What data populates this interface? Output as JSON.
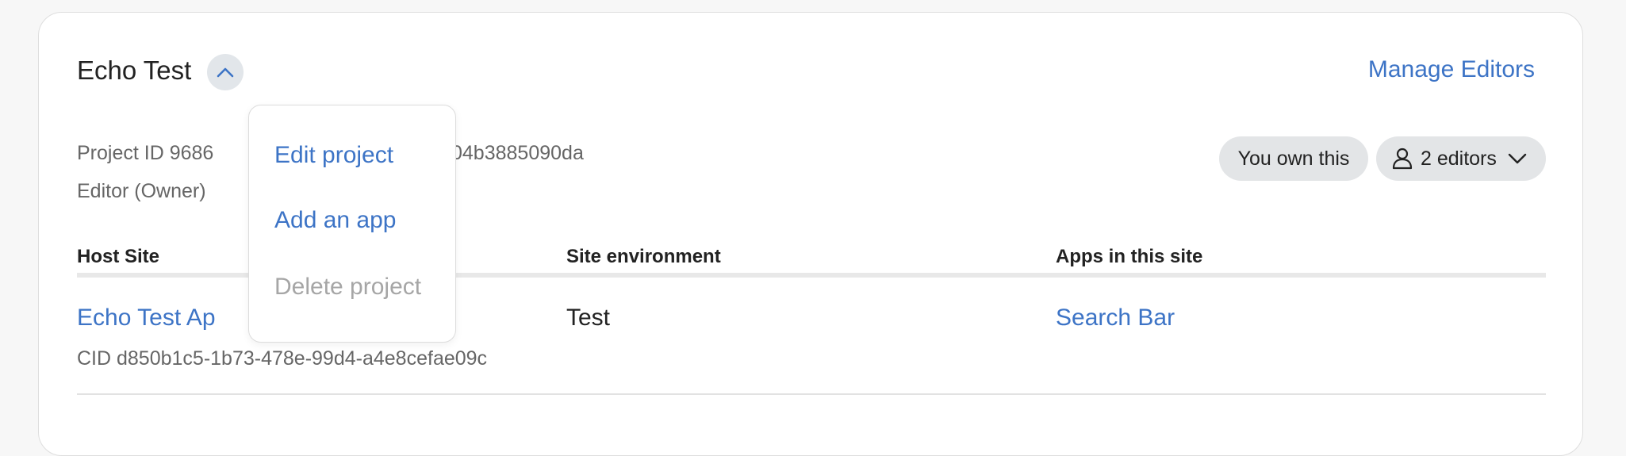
{
  "project": {
    "title": "Echo Test",
    "project_id_line": "Project ID 9686",
    "project_id_tail": "04b3885090da",
    "role_line": "Editor (Owner)"
  },
  "header": {
    "manage_editors": "Manage Editors",
    "ownership_badge": "You own this",
    "editors_count": "2 editors"
  },
  "table": {
    "columns": [
      "Host Site",
      "Site environment",
      "Apps in this site"
    ],
    "rows": [
      {
        "host_site": "Echo Test Ap",
        "environment": "Test",
        "apps": "Search Bar",
        "cid": "CID d850b1c5-1b73-478e-99d4-a4e8cefae09c"
      }
    ]
  },
  "menu": {
    "items": [
      {
        "label": "Edit project",
        "enabled": true
      },
      {
        "label": "Add an app",
        "enabled": true
      },
      {
        "label": "Delete project",
        "enabled": false
      }
    ]
  },
  "colors": {
    "accent": "#3d74c6",
    "pill_bg": "#e3e5e7",
    "disabled": "#a6a6a6"
  }
}
